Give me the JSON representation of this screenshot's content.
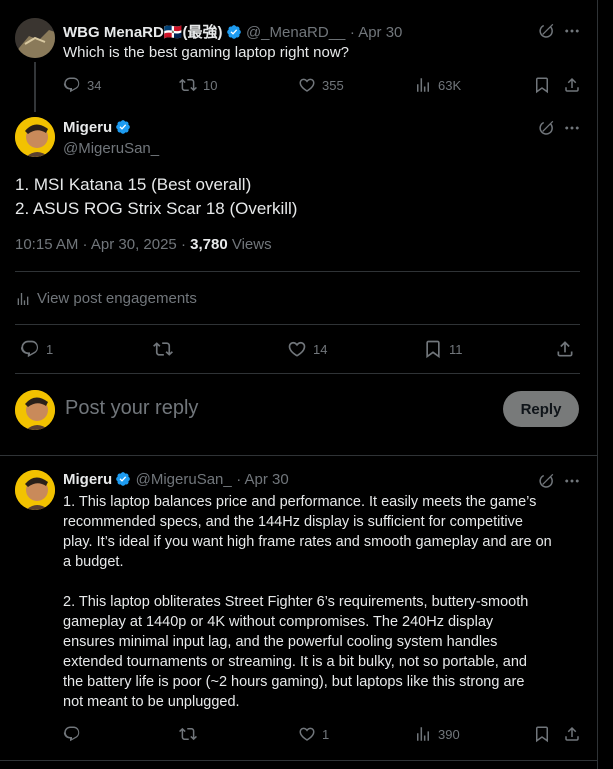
{
  "colors": {
    "background": "#000000",
    "text": "#e7e9ea",
    "muted": "#71767b",
    "verified": "#1d9bf0",
    "divider": "#2f3336",
    "reply_button_bg": "#eff3f4",
    "reply_button_text": "#0f1419"
  },
  "parent_tweet": {
    "author_name": "WBG MenaRD🇩🇴(最強)",
    "handle": "@_MenaRD__",
    "date": "· Apr 30",
    "text": "Which is the best gaming laptop right now?",
    "replies": "34",
    "reposts": "10",
    "likes": "355",
    "views": "63K"
  },
  "main_tweet": {
    "author_name": "Migeru",
    "handle": "@MigeruSan_",
    "line1": "1. MSI Katana 15 (Best overall)",
    "line2": "2. ASUS ROG Strix Scar 18 (Overkill)",
    "timestamp": "10:15 AM · Apr 30, 2025 ·",
    "views_count": "3,780",
    "views_label": "Views",
    "engagements_link": "View post engagements",
    "replies": "1",
    "likes": "14",
    "bookmarks": "11"
  },
  "reply_box": {
    "placeholder": "Post your reply",
    "button_label": "Reply"
  },
  "reply_tweet": {
    "author_name": "Migeru",
    "handle": "@MigeruSan_",
    "date": "· Apr 30",
    "para1_lines": [
      "1. This laptop balances price and performance. It easily meets the game’s",
      "recommended specs, and the 144Hz display is sufficient for competitive",
      "play. It’s ideal if you want high frame rates and smooth gameplay and are on",
      "a budget."
    ],
    "para2_lines": [
      "2. This laptop obliterates Street Fighter 6’s requirements,  buttery-smooth",
      "gameplay at 1440p or 4K without compromises. The 240Hz display",
      "ensures minimal input lag, and the powerful cooling system handles",
      "extended tournaments or streaming. It is a bit bulky, not so portable, and",
      "the battery life is poor (~2 hours gaming), but laptops like this strong are",
      "not meant to be unplugged."
    ],
    "likes": "1",
    "views": "390"
  },
  "icons": [
    "reply-icon",
    "repost-icon",
    "like-icon",
    "views-icon",
    "bookmark-icon",
    "share-icon",
    "grok-icon",
    "more-icon",
    "verified-icon"
  ]
}
